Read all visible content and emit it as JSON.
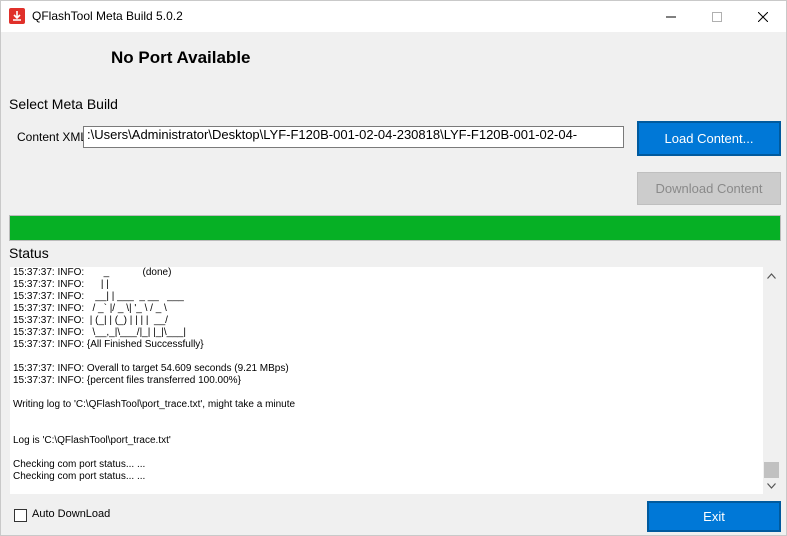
{
  "window": {
    "title": "QFlashTool Meta Build 5.0.2",
    "icon": "download-arrow-icon",
    "controls": [
      "minimize-icon",
      "maximize-icon",
      "close-icon"
    ]
  },
  "header": {
    "port_status": "No Port Available"
  },
  "meta_build": {
    "section_label": "Select Meta Build",
    "content_label": "Content XML",
    "content_path": ":\\Users\\Administrator\\Desktop\\LYF-F120B-001-02-04-230818\\LYF-F120B-001-02-04-",
    "load_button": "Load Content...",
    "download_button": "Download Content"
  },
  "progress": {
    "fraction": 1.0,
    "color": "#06b025"
  },
  "status": {
    "label": "Status",
    "log": "15:37:37: INFO:       _            (done)\n15:37:37: INFO:      | |\n15:37:37: INFO:    __| | ___  _ __   ___\n15:37:37: INFO:   / _` |/ _ \\| '_ \\ / _ \\\n15:37:37: INFO:  | (_| | (_) | | | |  __/\n15:37:37: INFO:   \\__,_|\\___/|_| |_|\\___|\n15:37:37: INFO: {All Finished Successfully}\n\n15:37:37: INFO: Overall to target 54.609 seconds (9.21 MBps)\n15:37:37: INFO: {percent files transferred 100.00%}\n\nWriting log to 'C:\\QFlashTool\\port_trace.txt', might take a minute\n\n\nLog is 'C:\\QFlashTool\\port_trace.txt'\n\nChecking com port status... ...\nChecking com port status... ..."
  },
  "footer": {
    "auto_download_label": "Auto DownLoad",
    "auto_download_checked": false,
    "exit_button": "Exit"
  },
  "colors": {
    "accent": "#0078d7",
    "progress": "#06b025",
    "disabled": "#cccccc"
  }
}
